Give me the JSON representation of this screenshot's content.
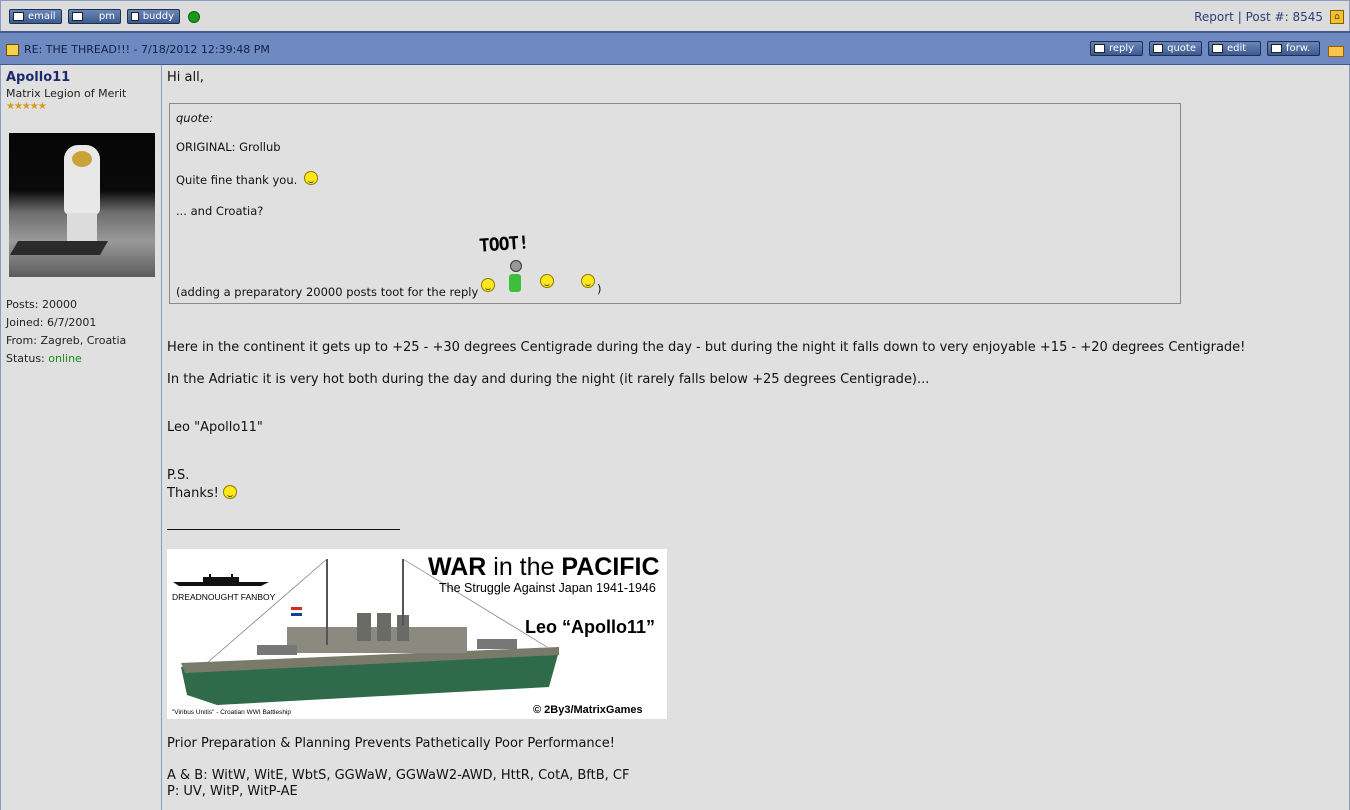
{
  "topbar": {
    "buttons": [
      "email",
      "pm",
      "buddy"
    ],
    "report_label": "Report",
    "separator": "|",
    "post_label": "Post #:",
    "post_number": "8545"
  },
  "post": {
    "title": "RE: THE THREAD!!! - 7/18/2012 12:39:48 PM",
    "actions": [
      "reply",
      "quote",
      "edit",
      "forw."
    ]
  },
  "author": {
    "name": "Apollo11",
    "rank": "Matrix Legion of Merit",
    "stars": "★★★★★",
    "posts_label": "Posts:",
    "posts": "20000",
    "joined_label": "Joined:",
    "joined": "6/7/2001",
    "from_label": "From:",
    "from": "Zagreb, Croatia",
    "status_label": "Status:",
    "status": "online"
  },
  "body": {
    "greeting": "Hi all,",
    "quote": {
      "label": "quote:",
      "original": "ORIGINAL: Grollub",
      "line1": "Quite fine thank you.",
      "line2": "... and Croatia?",
      "line3": "(adding a preparatory 20000 posts toot for the reply",
      "closing": ")",
      "toot": "TOOT!"
    },
    "para1": "Here in the continent it gets up to +25 - +30 degrees Centigrade during the day - but during the night it falls down to very enjoyable +15 - +20 degrees Centigrade!",
    "para2": "In the Adriatic it is very hot both during the day and during the night (it rarely falls below +25 degrees Centigrade)...",
    "signoff": "Leo \"Apollo11\"",
    "ps": "P.S.",
    "thanks": "Thanks!"
  },
  "signature": {
    "banner_title_bold1": "WAR",
    "banner_title_light": " in the ",
    "banner_title_bold2": "PACIFIC",
    "banner_sub": "The Struggle Against Japan 1941-1946",
    "banner_name": "Leo “Apollo11”",
    "banner_fanboy": "DREADNOUGHT FANBOY",
    "banner_caption": "\"Viribus Unitis\" - Croatian WWI Battleship",
    "banner_copy": "© 2By3/MatrixGames",
    "motto": "Prior Preparation & Planning Prevents Pathetically Poor Performance!",
    "ab_line": "A & B: WitW, WitE, WbtS, GGWaW, GGWaW2-AWD, HttR, CotA, BftB, CF",
    "p_line": "P: UV, WitP, WitP-AE"
  }
}
